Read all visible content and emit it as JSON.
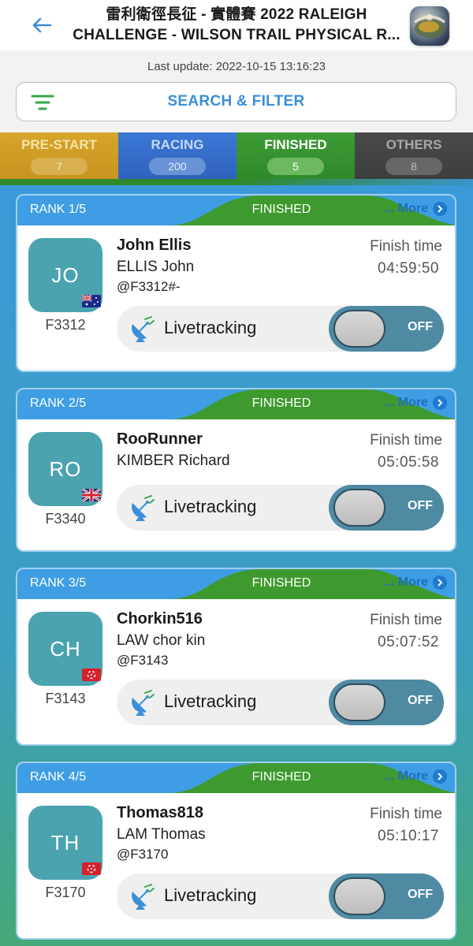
{
  "header": {
    "title_line1": "雷利衛徑長征 - 實體賽 2022 RALEIGH",
    "title_line2": "CHALLENGE - WILSON TRAIL PHYSICAL R..."
  },
  "last_update": "Last update: 2022-10-15 13:16:23",
  "search_filter": {
    "label": "SEARCH & FILTER"
  },
  "tabs": [
    {
      "label": "PRE-START",
      "count": "7",
      "color": "#d6a52a"
    },
    {
      "label": "RACING",
      "count": "200",
      "color": "#3b78d4"
    },
    {
      "label": "FINISHED",
      "count": "5",
      "color": "#3d9c35",
      "active": true
    },
    {
      "label": "OTHERS",
      "count": "8",
      "color": "#4a4a4a"
    }
  ],
  "cards": [
    {
      "rank": "RANK 1/5",
      "status": "FINISHED",
      "more": "... More",
      "initials": "JO",
      "flag": "australia",
      "bib": "F3312",
      "nickname": "John Ellis",
      "fullname": "ELLIS John",
      "handle": "@F3312#-",
      "finish_label": "Finish time",
      "finish_time": "04:59:50",
      "live_label": "Livetracking",
      "toggle": "OFF"
    },
    {
      "rank": "RANK 2/5",
      "status": "FINISHED",
      "more": "... More",
      "initials": "RO",
      "flag": "united-kingdom",
      "bib": "F3340",
      "nickname": "RooRunner",
      "fullname": "KIMBER Richard",
      "handle": "",
      "finish_label": "Finish time",
      "finish_time": "05:05:58",
      "live_label": "Livetracking",
      "toggle": "OFF"
    },
    {
      "rank": "RANK 3/5",
      "status": "FINISHED",
      "more": "... More",
      "initials": "CH",
      "flag": "hong-kong",
      "bib": "F3143",
      "nickname": "Chorkin516",
      "fullname": "LAW chor kin",
      "handle": "@F3143",
      "finish_label": "Finish time",
      "finish_time": "05:07:52",
      "live_label": "Livetracking",
      "toggle": "OFF"
    },
    {
      "rank": "RANK 4/5",
      "status": "FINISHED",
      "more": "... More",
      "initials": "TH",
      "flag": "hong-kong",
      "bib": "F3170",
      "nickname": "Thomas818",
      "fullname": "LAM Thomas",
      "handle": "@F3170",
      "finish_label": "Finish time",
      "finish_time": "05:10:17",
      "live_label": "Livetracking",
      "toggle": "OFF"
    }
  ]
}
